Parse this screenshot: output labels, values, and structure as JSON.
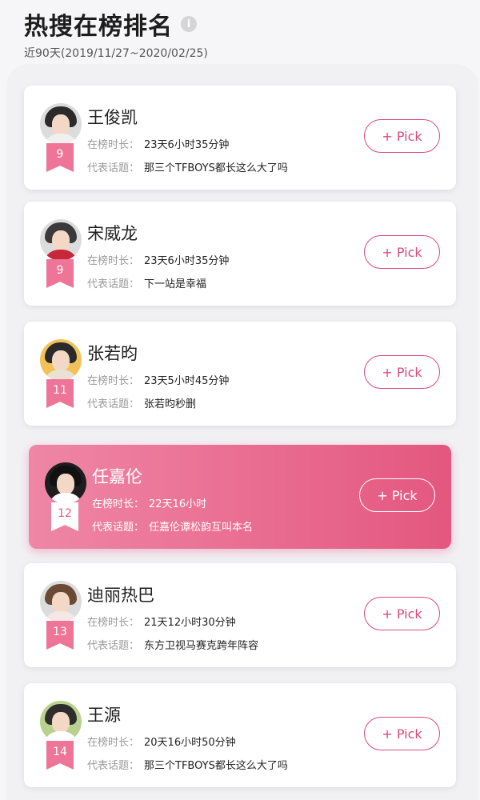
{
  "header": {
    "title": "热搜在榜排名",
    "info_icon": "i",
    "subtitle": "近90天(2019/11/27~2020/02/25)"
  },
  "labels": {
    "duration": "在榜时长：",
    "topic": "代表话题：",
    "pick": "+ Pick"
  },
  "colors": {
    "accent": "#e4577f",
    "flag": "#ee7597"
  },
  "entries": [
    {
      "rank": "9",
      "name": "王俊凯",
      "duration": "23天6小时35分钟",
      "topic": "那三个TFBOYS都长这么大了吗",
      "highlighted": false
    },
    {
      "rank": "9",
      "name": "宋威龙",
      "duration": "23天6小时35分钟",
      "topic": "下一站是幸福",
      "highlighted": false
    },
    {
      "rank": "11",
      "name": "张若昀",
      "duration": "23天5小时45分钟",
      "topic": "张若昀秒删",
      "highlighted": false
    },
    {
      "rank": "12",
      "name": "任嘉伦",
      "duration": "22天16小时",
      "topic": "任嘉伦谭松韵互叫本名",
      "highlighted": true
    },
    {
      "rank": "13",
      "name": "迪丽热巴",
      "duration": "21天12小时30分钟",
      "topic": "东方卫视马赛克跨年阵容",
      "highlighted": false
    },
    {
      "rank": "14",
      "name": "王源",
      "duration": "20天16小时50分钟",
      "topic": "那三个TFBOYS都长这么大了吗",
      "highlighted": false
    }
  ]
}
